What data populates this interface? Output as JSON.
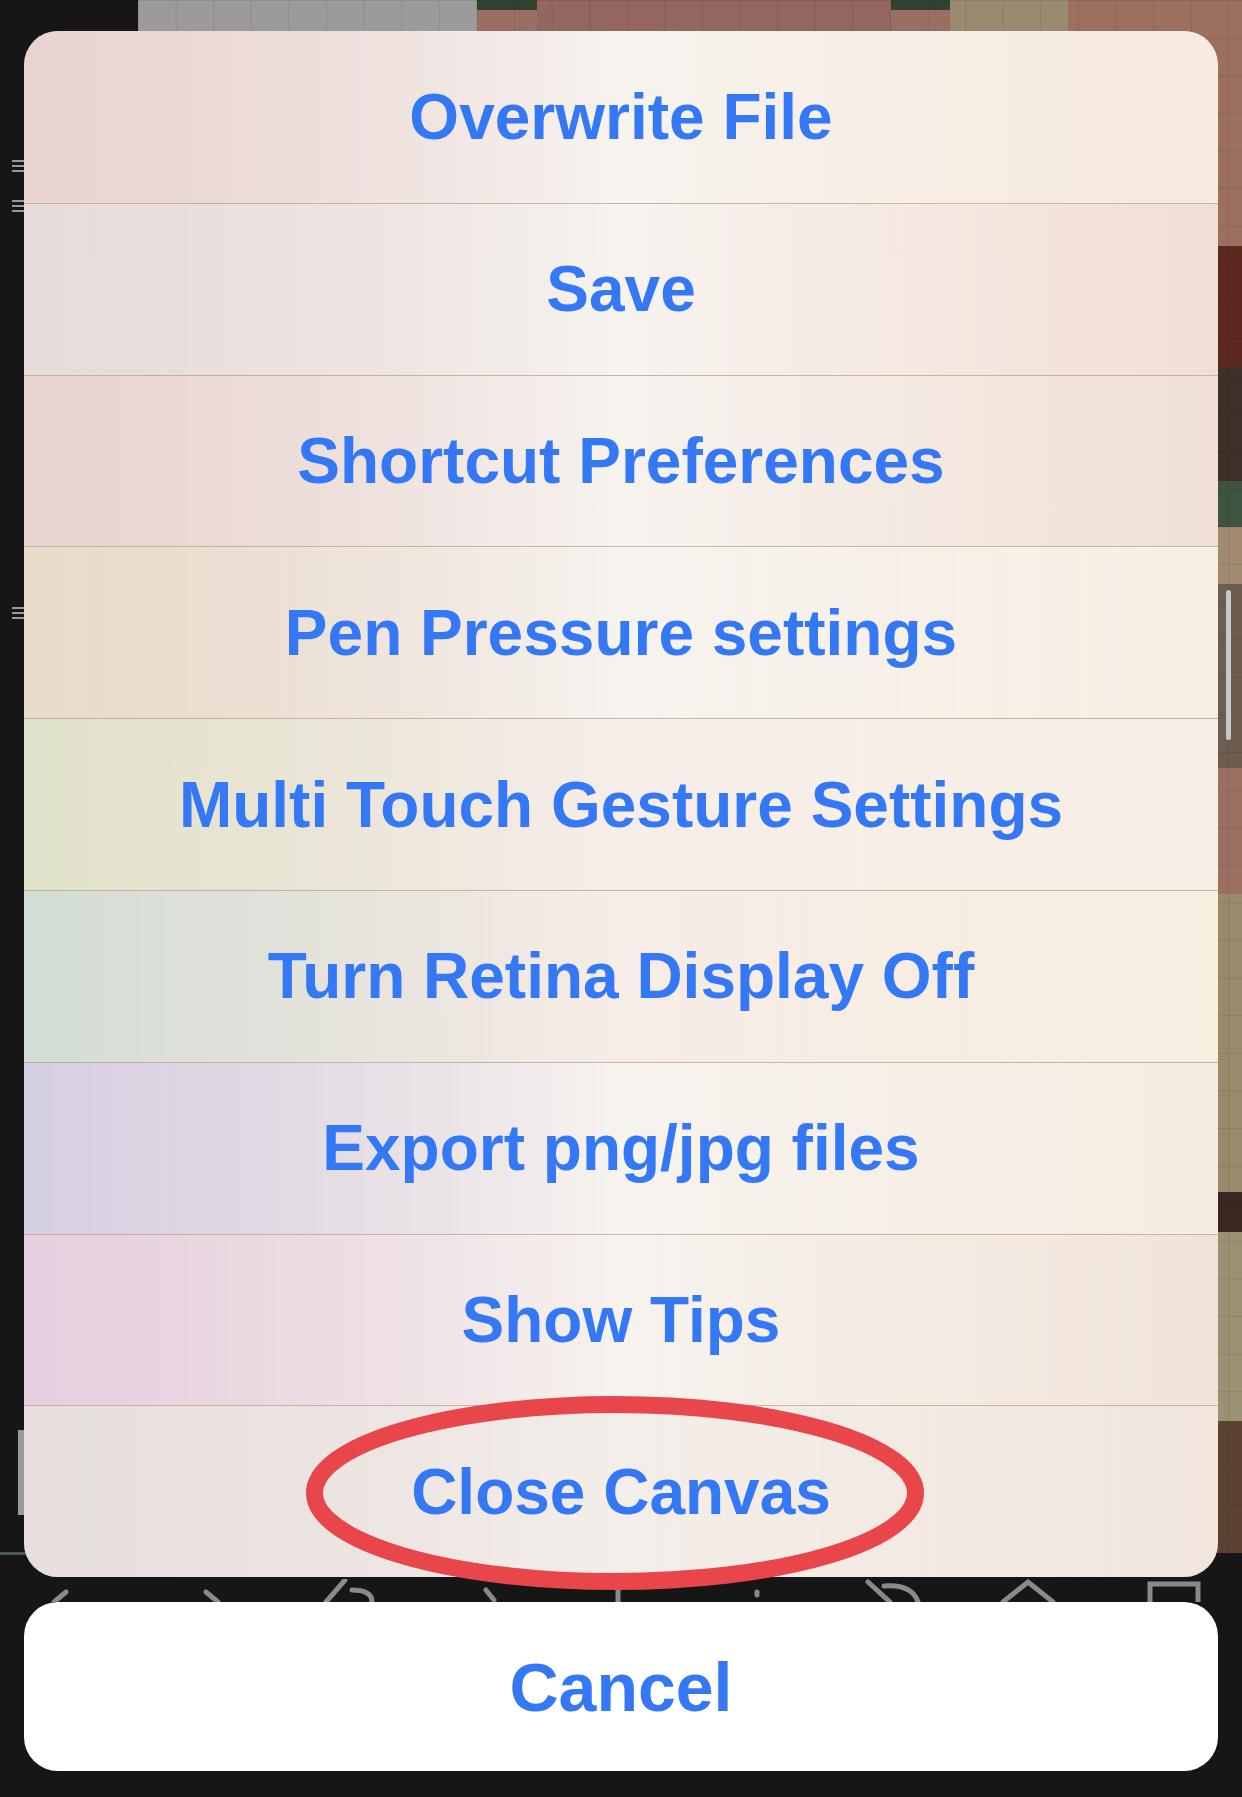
{
  "action_sheet": {
    "items": [
      {
        "label": "Overwrite File",
        "circled": false
      },
      {
        "label": "Save",
        "circled": false
      },
      {
        "label": "Shortcut Preferences",
        "circled": false
      },
      {
        "label": "Pen Pressure settings",
        "circled": false
      },
      {
        "label": "Multi Touch Gesture Settings",
        "circled": false
      },
      {
        "label": "Turn Retina Display Off",
        "circled": false
      },
      {
        "label": "Export png/jpg files",
        "circled": false
      },
      {
        "label": "Show Tips",
        "circled": false
      },
      {
        "label": "Close Canvas",
        "circled": true
      }
    ]
  },
  "cancel_button": {
    "label": "Cancel"
  }
}
